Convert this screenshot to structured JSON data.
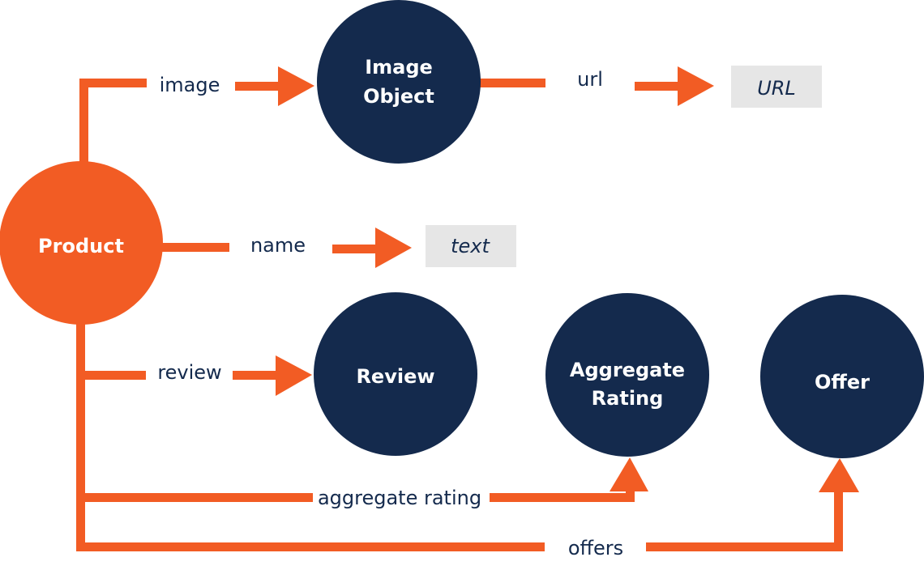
{
  "colors": {
    "orange": "#f25c24",
    "navy": "#142a4d",
    "literal_bg": "#e6e6e6",
    "white": "#ffffff"
  },
  "nodes": {
    "product": {
      "label": "Product"
    },
    "image_object": {
      "lines": [
        "Image",
        "Object"
      ]
    },
    "review": {
      "label": "Review"
    },
    "aggregate_rating": {
      "lines": [
        "Aggregate",
        "Rating"
      ]
    },
    "offer": {
      "label": "Offer"
    }
  },
  "literals": {
    "url": "URL",
    "text": "text"
  },
  "edges": {
    "image": "image",
    "url": "url",
    "name": "name",
    "review": "review",
    "aggregate_rating": "aggregate rating",
    "offers": "offers"
  }
}
